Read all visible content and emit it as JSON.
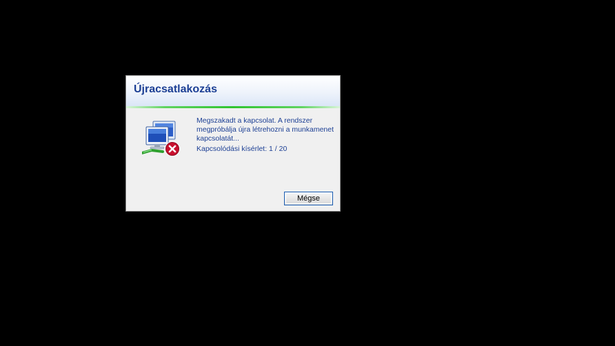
{
  "dialog": {
    "title": "Újracsatlakozás",
    "message": "Megszakadt a kapcsolat. A rendszer megpróbálja újra létrehozni a munkamenet kapcsolatát...",
    "attempt_text": "Kapcsolódási kísérlet: 1 / 20",
    "cancel_label": "Mégse",
    "icon": "network-error-icon"
  },
  "colors": {
    "background": "#000000",
    "title": "#1c3f94",
    "accent_line": "#2fc42f",
    "error_badge": "#c8102e"
  }
}
